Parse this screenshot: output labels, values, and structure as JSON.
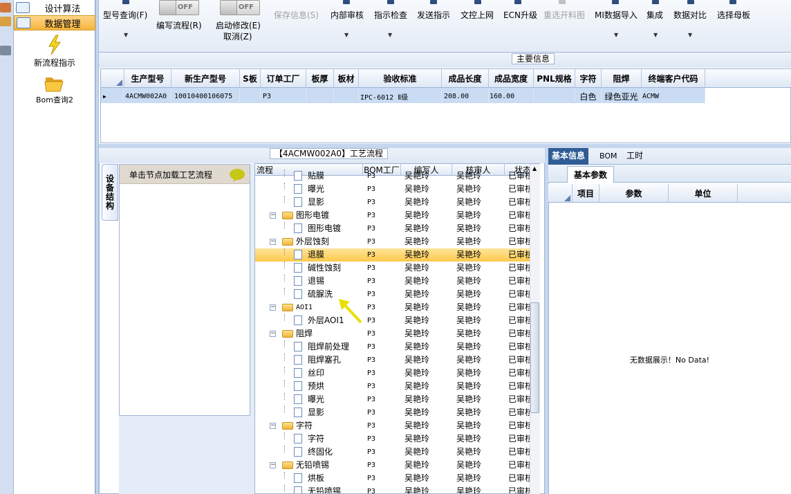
{
  "left_nav": {
    "items": [
      {
        "label": "设计算法",
        "icon": "grid-icon",
        "active": false
      },
      {
        "label": "数据管理",
        "icon": "grid-icon",
        "active": true
      }
    ],
    "big_items": [
      {
        "label": "新流程指示",
        "icon": "lightning-icon"
      },
      {
        "label": "Bom查询2",
        "icon": "folder-open-icon"
      }
    ]
  },
  "toolbar": {
    "model_query": "型号查询(F)",
    "write_flow": "编写流程(R)",
    "toggle1_text": "OFF",
    "toggle2_text": "OFF",
    "start_modify": "启动修改(E)",
    "cancel": "取消(Z)",
    "save_info": "保存信息(S)",
    "internal_review": "内部审核",
    "indicator_check": "指示检查",
    "send_indicator": "发送指示",
    "doc_control_online": "文控上网",
    "ecn_upgrade": "ECN升级",
    "reselect_material": "重选开料图",
    "mi_import": "MI数据导入",
    "integrate": "集成",
    "data_compare": "数据对比",
    "select_master": "选择母板"
  },
  "main_info": {
    "group_title": "主要信息",
    "columns": [
      "生产型号",
      "新生产型号",
      "S板",
      "订单工厂",
      "板厚",
      "板材",
      "验收标准",
      "成品长度",
      "成品宽度",
      "PNL规格",
      "字符",
      "阻焊",
      "终端客户代码"
    ],
    "row": [
      "4ACMW002A0",
      "10010400106075",
      "",
      "P3",
      "",
      "",
      "IPC-6012 Ⅱ级",
      "208.00",
      "160.00",
      "",
      "白色",
      "绿色亚光",
      "ACMW"
    ]
  },
  "process": {
    "group_title": "【4ACMW002A0】工艺流程",
    "equip_tab": "设备结构",
    "equip_hint": "单击节点加载工艺流程",
    "columns": [
      "流程",
      "BOM工厂",
      "编写人",
      "核审人",
      "状态"
    ],
    "rows": [
      {
        "name": "贴膜",
        "level": 2,
        "factory": "P3",
        "writer": "吴艳玲",
        "reviewer": "吴艳玲",
        "status": "已审核"
      },
      {
        "name": "曝光",
        "level": 2,
        "factory": "P3",
        "writer": "吴艳玲",
        "reviewer": "吴艳玲",
        "status": "已审核"
      },
      {
        "name": "显影",
        "level": 2,
        "factory": "P3",
        "writer": "吴艳玲",
        "reviewer": "吴艳玲",
        "status": "已审核"
      },
      {
        "name": "图形电镀",
        "level": 1,
        "factory": "P3",
        "writer": "吴艳玲",
        "reviewer": "吴艳玲",
        "status": "已审核"
      },
      {
        "name": "图形电镀",
        "level": 2,
        "factory": "P3",
        "writer": "吴艳玲",
        "reviewer": "吴艳玲",
        "status": "已审核"
      },
      {
        "name": "外层蚀刻",
        "level": 1,
        "factory": "P3",
        "writer": "吴艳玲",
        "reviewer": "吴艳玲",
        "status": "已审核"
      },
      {
        "name": "退膜",
        "level": 2,
        "factory": "P3",
        "writer": "吴艳玲",
        "reviewer": "吴艳玲",
        "status": "已审核",
        "selected": true
      },
      {
        "name": "碱性蚀刻",
        "level": 2,
        "factory": "P3",
        "writer": "吴艳玲",
        "reviewer": "吴艳玲",
        "status": "已审核"
      },
      {
        "name": "退锡",
        "level": 2,
        "factory": "P3",
        "writer": "吴艳玲",
        "reviewer": "吴艳玲",
        "status": "已审核"
      },
      {
        "name": "硫脲洗",
        "level": 2,
        "factory": "P3",
        "writer": "吴艳玲",
        "reviewer": "吴艳玲",
        "status": "已审核"
      },
      {
        "name": "AOI1",
        "level": 1,
        "factory": "P3",
        "writer": "吴艳玲",
        "reviewer": "吴艳玲",
        "status": "已审核"
      },
      {
        "name": "外层AOI1",
        "level": 2,
        "factory": "P3",
        "writer": "吴艳玲",
        "reviewer": "吴艳玲",
        "status": "已审核"
      },
      {
        "name": "阻焊",
        "level": 1,
        "factory": "P3",
        "writer": "吴艳玲",
        "reviewer": "吴艳玲",
        "status": "已审核"
      },
      {
        "name": "阻焊前处理",
        "level": 2,
        "factory": "P3",
        "writer": "吴艳玲",
        "reviewer": "吴艳玲",
        "status": "已审核"
      },
      {
        "name": "阻焊塞孔",
        "level": 2,
        "factory": "P3",
        "writer": "吴艳玲",
        "reviewer": "吴艳玲",
        "status": "已审核"
      },
      {
        "name": "丝印",
        "level": 2,
        "factory": "P3",
        "writer": "吴艳玲",
        "reviewer": "吴艳玲",
        "status": "已审核"
      },
      {
        "name": "预烘",
        "level": 2,
        "factory": "P3",
        "writer": "吴艳玲",
        "reviewer": "吴艳玲",
        "status": "已审核"
      },
      {
        "name": "曝光",
        "level": 2,
        "factory": "P3",
        "writer": "吴艳玲",
        "reviewer": "吴艳玲",
        "status": "已审核"
      },
      {
        "name": "显影",
        "level": 2,
        "factory": "P3",
        "writer": "吴艳玲",
        "reviewer": "吴艳玲",
        "status": "已审核"
      },
      {
        "name": "字符",
        "level": 1,
        "factory": "P3",
        "writer": "吴艳玲",
        "reviewer": "吴艳玲",
        "status": "已审核"
      },
      {
        "name": "字符",
        "level": 2,
        "factory": "P3",
        "writer": "吴艳玲",
        "reviewer": "吴艳玲",
        "status": "已审核"
      },
      {
        "name": "终固化",
        "level": 2,
        "factory": "P3",
        "writer": "吴艳玲",
        "reviewer": "吴艳玲",
        "status": "已审核"
      },
      {
        "name": "无铅喷锡",
        "level": 1,
        "factory": "P3",
        "writer": "吴艳玲",
        "reviewer": "吴艳玲",
        "status": "已审核"
      },
      {
        "name": "烘板",
        "level": 2,
        "factory": "P3",
        "writer": "吴艳玲",
        "reviewer": "吴艳玲",
        "status": "已审核"
      },
      {
        "name": "无铅喷锡",
        "level": 2,
        "factory": "P3",
        "writer": "吴艳玲",
        "reviewer": "吴艳玲",
        "status": "已审核"
      }
    ]
  },
  "right_panel": {
    "tabs": [
      "基本信息",
      "BOM",
      "工时"
    ],
    "sub_tab": "基本参数",
    "columns": [
      "项目",
      "参数",
      "单位"
    ],
    "empty_text": "无数据展示！No Data!"
  },
  "colors": {
    "accent": "#2f5d95",
    "selection": "#fcc94d",
    "nav_active": "#f5b53c",
    "grid_selected_row": "#c9dcf4",
    "cursor": "#e8e000"
  }
}
